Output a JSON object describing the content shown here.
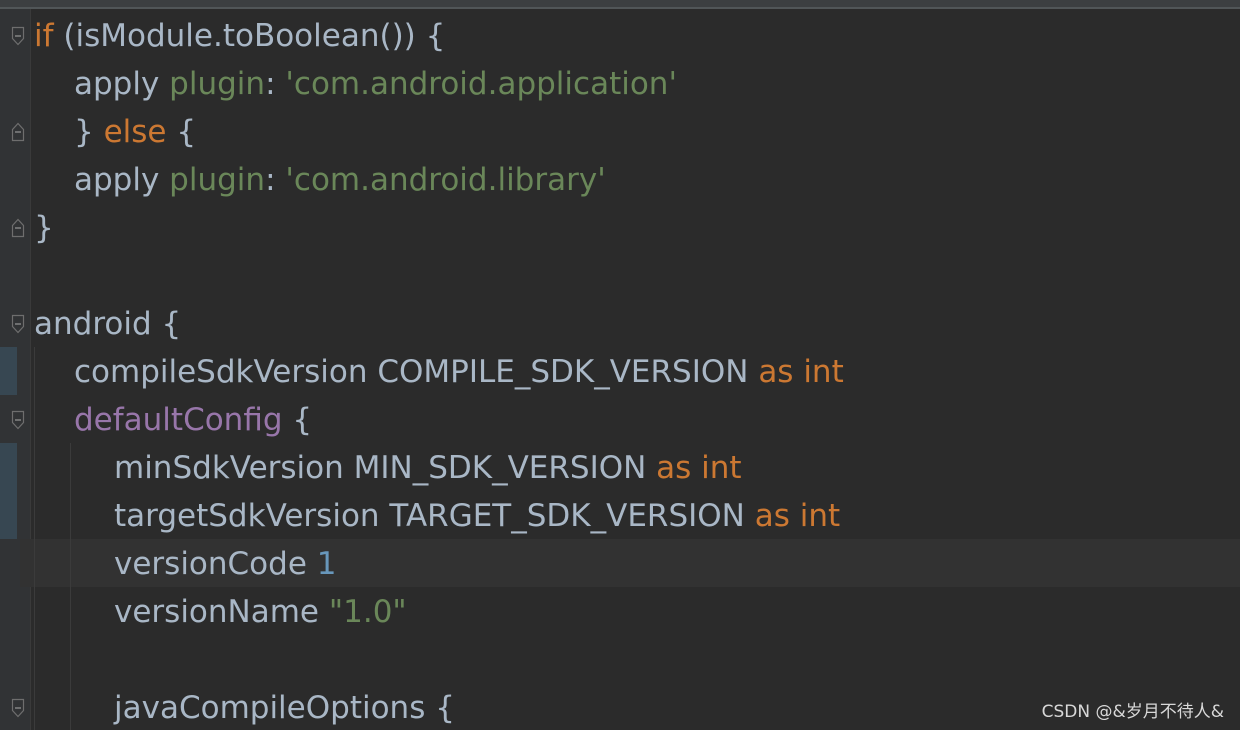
{
  "editor": {
    "theme_colors": {
      "background": "#2b2b2b",
      "keyword": "#cc7832",
      "string": "#6a8759",
      "number": "#6897bb",
      "property": "#9876aa",
      "text": "#a9b7c6"
    },
    "lines": [
      {
        "tokens": [
          {
            "t": "kw",
            "v": "if"
          },
          {
            "t": "plain",
            "v": " (isModule.toBoolean()) {"
          }
        ]
      },
      {
        "tokens": [
          {
            "t": "plain",
            "v": "apply "
          },
          {
            "t": "named",
            "v": "plugin"
          },
          {
            "t": "plain",
            "v": ": "
          },
          {
            "t": "str",
            "v": "'com.android.application'"
          }
        ]
      },
      {
        "tokens": [
          {
            "t": "plain",
            "v": "} "
          },
          {
            "t": "kw",
            "v": "else"
          },
          {
            "t": "plain",
            "v": " {"
          }
        ]
      },
      {
        "tokens": [
          {
            "t": "plain",
            "v": "apply "
          },
          {
            "t": "named",
            "v": "plugin"
          },
          {
            "t": "plain",
            "v": ": "
          },
          {
            "t": "str",
            "v": "'com.android.library'"
          }
        ]
      },
      {
        "tokens": [
          {
            "t": "plain",
            "v": "}"
          }
        ]
      },
      {
        "tokens": []
      },
      {
        "tokens": [
          {
            "t": "plain",
            "v": "android {"
          }
        ]
      },
      {
        "tokens": [
          {
            "t": "plain",
            "v": "compileSdkVersion COMPILE_SDK_VERSION "
          },
          {
            "t": "kw",
            "v": "as int"
          }
        ]
      },
      {
        "tokens": [
          {
            "t": "prop",
            "v": "defaultConfig"
          },
          {
            "t": "plain",
            "v": " {"
          }
        ]
      },
      {
        "tokens": [
          {
            "t": "plain",
            "v": "minSdkVersion MIN_SDK_VERSION "
          },
          {
            "t": "kw",
            "v": "as int"
          }
        ]
      },
      {
        "tokens": [
          {
            "t": "plain",
            "v": "targetSdkVersion TARGET_SDK_VERSION "
          },
          {
            "t": "kw",
            "v": "as int"
          }
        ]
      },
      {
        "tokens": [
          {
            "t": "plain",
            "v": "versionCode "
          },
          {
            "t": "num",
            "v": "1"
          }
        ]
      },
      {
        "tokens": [
          {
            "t": "plain",
            "v": "versionName "
          },
          {
            "t": "str",
            "v": "\"1.0\""
          }
        ]
      },
      {
        "tokens": []
      },
      {
        "tokens": [
          {
            "t": "plain",
            "v": "javaCompileOptions {"
          }
        ]
      }
    ]
  },
  "watermark": {
    "text": "CSDN @&岁月不待人&"
  }
}
